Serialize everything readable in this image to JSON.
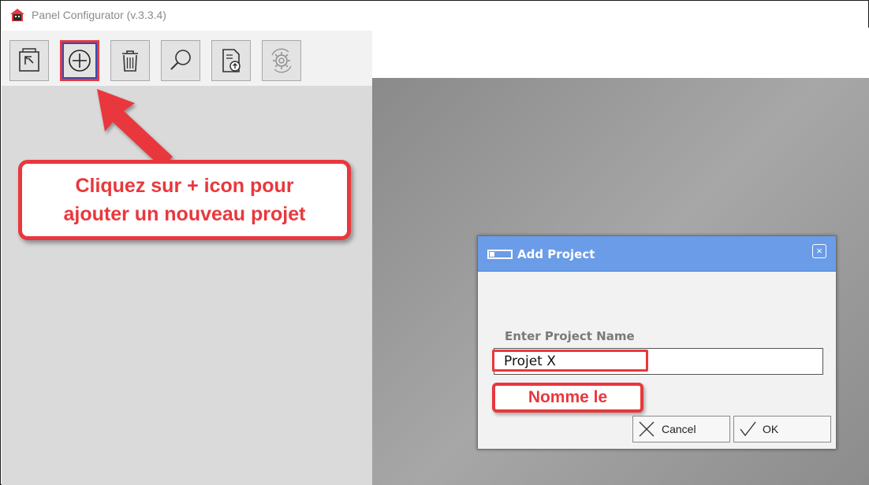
{
  "app": {
    "title": "Panel Configurator (v.3.3.4)"
  },
  "toolbar": {
    "buttons": [
      {
        "name": "import-icon"
      },
      {
        "name": "add-icon"
      },
      {
        "name": "delete-icon"
      },
      {
        "name": "search-icon"
      },
      {
        "name": "export-icon"
      },
      {
        "name": "sync-icon"
      }
    ]
  },
  "annotation": {
    "callout_line1": "Cliquez sur + icon pour",
    "callout_line2": "ajouter un nouveau projet",
    "input_callout": "Nomme le",
    "color": "#e8383d"
  },
  "dialog": {
    "title": "Add Project",
    "close_glyph": "×",
    "field_label": "Enter Project Name",
    "field_value": "Projet X",
    "cancel_label": "Cancel",
    "ok_label": "OK",
    "title_bar_color": "#6a9ce8"
  }
}
